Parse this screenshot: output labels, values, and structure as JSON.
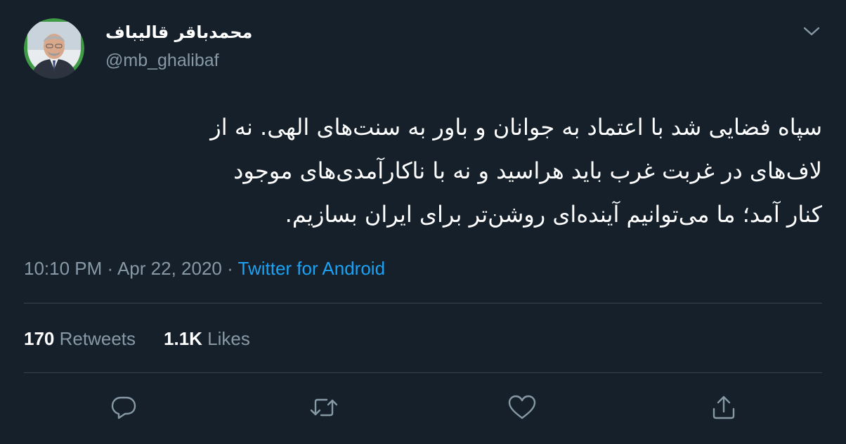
{
  "author": {
    "display_name": "محمدباقر قالیباف",
    "handle": "@mb_ghalibaf",
    "avatar_icon": "profile-photo"
  },
  "tweet": {
    "lines": [
      "سپاه فضایی شد با اعتماد به جوانان و باور به سنت‌های الهی. نه از",
      "لاف‌های در غربت غرب باید هراسید و نه با ناکارآمدی‌های موجود",
      "کنار آمد؛ ما می‌توانیم آینده‌ای روشن‌تر برای ایران بسازیم."
    ]
  },
  "meta": {
    "time": "10:10 PM",
    "separator1": " · ",
    "date": "Apr 22, 2020",
    "separator2": " · ",
    "source": "Twitter for Android"
  },
  "stats": {
    "retweets_count": "170",
    "retweets_label": "Retweets",
    "likes_count": "1.1K",
    "likes_label": "Likes"
  },
  "colors": {
    "background": "#15202b",
    "text": "#ffffff",
    "muted": "#8899a6",
    "accent": "#1da1f2",
    "divider": "#38444d"
  },
  "actions": [
    "reply-icon",
    "retweet-icon",
    "like-icon",
    "share-icon"
  ]
}
